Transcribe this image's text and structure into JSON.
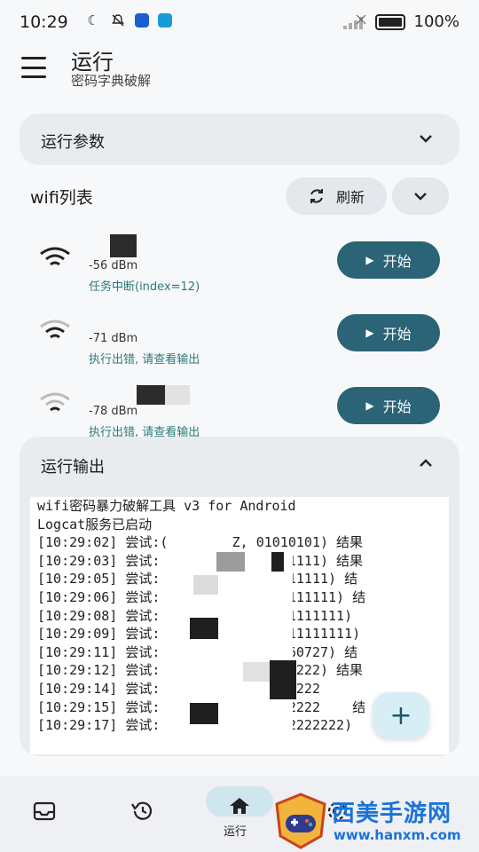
{
  "status_bar": {
    "time": "10:29",
    "battery": "100%"
  },
  "header": {
    "title": "运行",
    "subtitle": "密码字典破解"
  },
  "params": {
    "title": "运行参数"
  },
  "wifi": {
    "header": "wifi列表",
    "refresh_label": "刷新",
    "items": [
      {
        "rssi": "-56 dBm",
        "state": "任务中断(index=12)",
        "start_label": "开始"
      },
      {
        "rssi": "-71 dBm",
        "state": "执行出错, 请查看输出",
        "start_label": "开始"
      },
      {
        "rssi": "-78 dBm",
        "state": "执行出错, 请查看输出",
        "start_label": "开始"
      }
    ]
  },
  "output": {
    "title": "运行输出",
    "lines": [
      "wifi密码暴力破解工具 v3 for Android",
      "",
      "Logcat服务已启动",
      "[10:29:02] 尝试:(        Z, 01010101) 结果",
      "[10:29:03] 尝试:         Z, 11111111) 结果",
      "[10:29:05] 尝试:         Z, 111111111) 结",
      "[10:29:06] 尝试:         Z, 1111111111) 结",
      "[10:29:08] 尝试:         Z, 11111111111)",
      "[10:29:09] 尝试:         Z, 111111111111)",
      "[10:29:11] 尝试:         Z, XTN960727) 结",
      "[10:29:12] 尝试:         Z, 22222222) 结果",
      "[10:29:14] 尝试:         Z, 22222222",
      "[10:29:15] 尝试:         Z, 22222222    结",
      "[10:29:17] 尝试:         Z, 22222222222)"
    ]
  },
  "fab": {
    "label": "+"
  },
  "bottom_nav": {
    "active_label": "运行"
  },
  "watermark": {
    "name": "西美手游网",
    "url": "www.hanxm.com"
  },
  "colors": {
    "accent": "#2a6476",
    "state": "#2b7a78",
    "card": "#e9ecef"
  }
}
